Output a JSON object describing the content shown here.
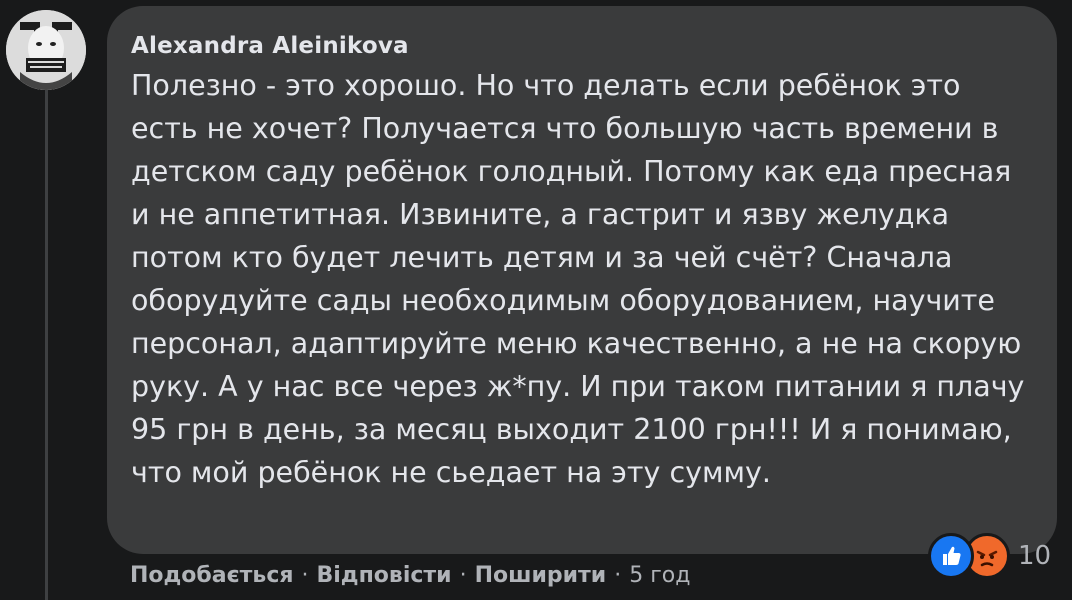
{
  "comment": {
    "author": "Alexandra Aleinikova",
    "text": "Полезно - это хорошо. Но что делать если ребёнок это есть не хочет? Получается что большую часть времени в детском саду ребёнок голодный. Потому как еда пресная и не аппетитная. Извините, а гастрит и язву желудка потом кто будет лечить детям и за чей счёт? Сначала оборудуйте сады необходимым оборудованием, научите персонал, адаптируйте меню качественно, а не на скорую руку. А у нас все через ж*пу. И при таком питании я плачу 95 грн в день, за месяц выходит 2100 грн!!! И я понимаю, что мой ребёнок не сьедает на эту сумму.",
    "reactions": {
      "icons": [
        "like-icon",
        "angry-icon"
      ],
      "count": "10"
    }
  },
  "actions": {
    "like_label": "Подобається",
    "reply_label": "Відповісти",
    "share_label": "Поширити",
    "separator": "·",
    "timestamp": "5 год"
  },
  "colors": {
    "background": "#18191a",
    "bubble": "#3a3b3c",
    "text_primary": "#e4e6eb",
    "text_secondary": "#b0b3b8",
    "like_blue": "#1877f2",
    "angry_orange": "#f0692b"
  }
}
